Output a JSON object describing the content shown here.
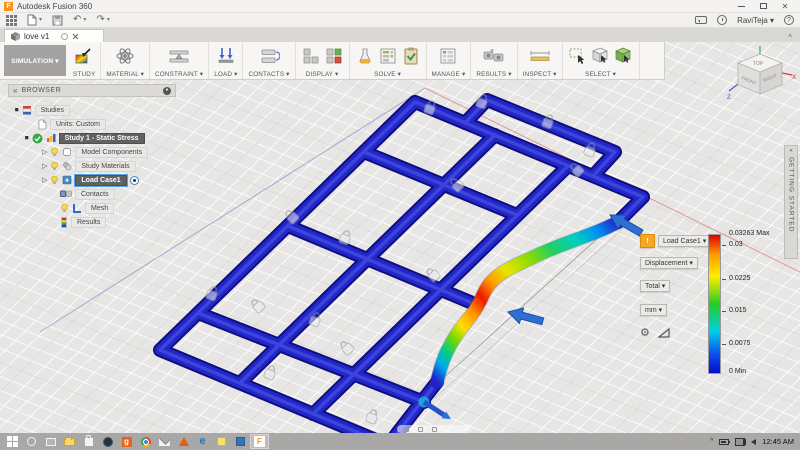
{
  "window": {
    "app_title": "Autodesk Fusion 360",
    "user_menu": "RaviTeja ▾"
  },
  "icons": {
    "undo": "↶",
    "redo": "↷",
    "caret": "▾",
    "collapse": "^",
    "chevrons": "«",
    "help": "?",
    "expand_triangle": "◆",
    "collapsed_triangle": "▷"
  },
  "tab": {
    "doc_name": "love v1"
  },
  "toolbar": {
    "workspace_label": "SIMULATION ▾",
    "groups": [
      {
        "label": "STUDY"
      },
      {
        "label": "MATERIAL ▾"
      },
      {
        "label": "CONSTRAINT ▾"
      },
      {
        "label": "LOAD ▾"
      },
      {
        "label": "CONTACTS ▾"
      },
      {
        "label": "DISPLAY ▾"
      },
      {
        "label": "SOLVE ▾"
      },
      {
        "label": "MANAGE ▾"
      },
      {
        "label": "RESULTS ▾"
      },
      {
        "label": "INSPECT ▾"
      },
      {
        "label": "SELECT ▾"
      }
    ]
  },
  "browser": {
    "header": "BROWSER",
    "items": [
      {
        "label": "Studies"
      },
      {
        "label": "Units: Custom"
      },
      {
        "label": "Study 1 - Static Stress"
      },
      {
        "label": "Model Components"
      },
      {
        "label": "Study Materials"
      },
      {
        "label": "Load Case1"
      },
      {
        "label": "Contacts"
      },
      {
        "label": "Mesh"
      },
      {
        "label": "Results"
      }
    ]
  },
  "legend": {
    "warning_glyph": "!",
    "load_case": "Load Case1 ▾",
    "result_type": "Displacement  ▾",
    "component": "Total ▾",
    "unit": "mm  ▾",
    "gear_glyph": "⚙",
    "scale_ticks": [
      "0.03263 Max",
      "0.03",
      "0.0225",
      "0.015",
      "0.0075",
      "0 Min"
    ]
  },
  "viewcube": {
    "top": "TOP",
    "front": "FRONT",
    "right": "RIGHT",
    "axis_x": "X",
    "axis_z": "Z"
  },
  "getting_started_label": "GETTING STARTED",
  "taskbar": {
    "time": "12:45 AM",
    "glyphs": {
      "g_app": "g",
      "edge": "e",
      "fusion": "F"
    }
  },
  "colors": {
    "model_blue": "#1c1cc0",
    "max_red": "#ee1800",
    "accent_orange": "#f5a623",
    "selection_blue": "#58a6e8"
  }
}
